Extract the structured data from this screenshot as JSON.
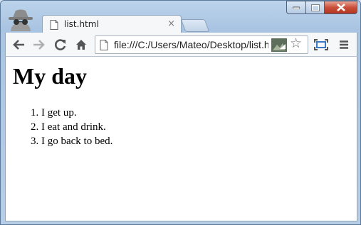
{
  "browser": {
    "tab": {
      "title": "list.html",
      "close": "×"
    },
    "address_bar": {
      "url": "file:///C:/Users/Mateo/Desktop/list.html"
    },
    "star": "☆"
  },
  "page": {
    "heading": "My day",
    "items": [
      "I get up.",
      "I eat and drink.",
      "I go back to bed."
    ]
  }
}
